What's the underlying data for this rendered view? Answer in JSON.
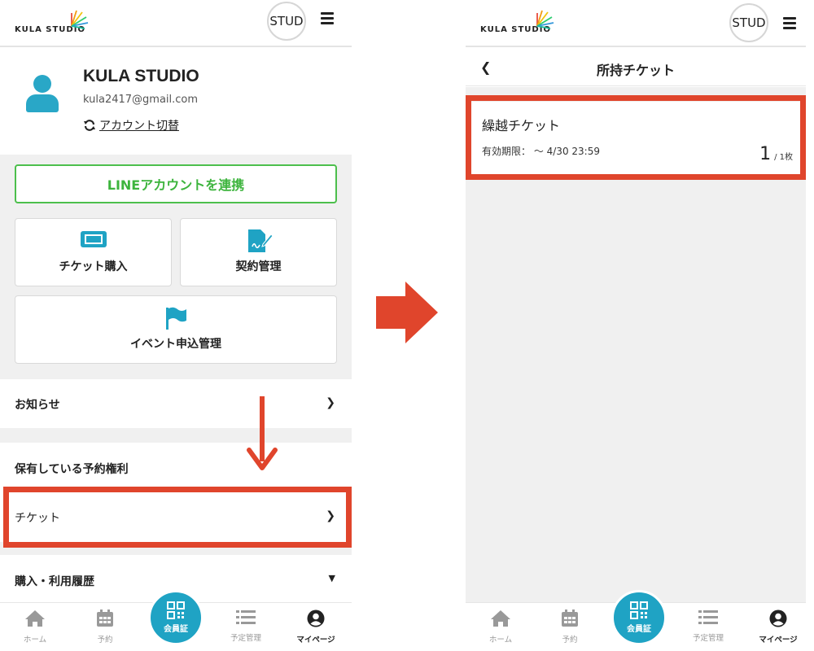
{
  "header": {
    "logo_text": "KULA STUDIO",
    "avatar_button": "STUD"
  },
  "left": {
    "profile": {
      "name": "KULA STUDIO",
      "email": "kula2417@gmail.com",
      "switch_account": "アカウント切替"
    },
    "line_button": "LINEアカウントを連携",
    "tiles": {
      "ticket_purchase": "チケット購入",
      "contract_management": "契約管理",
      "event_management": "イベント申込管理"
    },
    "news": "お知らせ",
    "reservation_rights_heading": "保有している予約権利",
    "ticket_row": "チケット",
    "history": "購入・利用履歴"
  },
  "right": {
    "title": "所持チケット",
    "ticket": {
      "name": "繰越チケット",
      "expiry": "有効期限：  〜 4/30 23:59",
      "count": "1",
      "total": "/ 1枚"
    }
  },
  "bottom_nav": {
    "home": "ホーム",
    "reserve": "予約",
    "member_card": "会員証",
    "schedule": "予定管理",
    "mypage": "マイページ"
  },
  "colors": {
    "accent": "#1fa3c4",
    "line_green": "#3db43d",
    "highlight": "#e0452c"
  },
  "icons": [
    "sync-icon",
    "ticket-icon",
    "contract-icon",
    "flag-icon",
    "chevron-right-icon",
    "chevron-down-icon",
    "home-icon",
    "calendar-icon",
    "qr-icon",
    "list-icon",
    "user-circle-icon",
    "chevron-left-icon"
  ]
}
